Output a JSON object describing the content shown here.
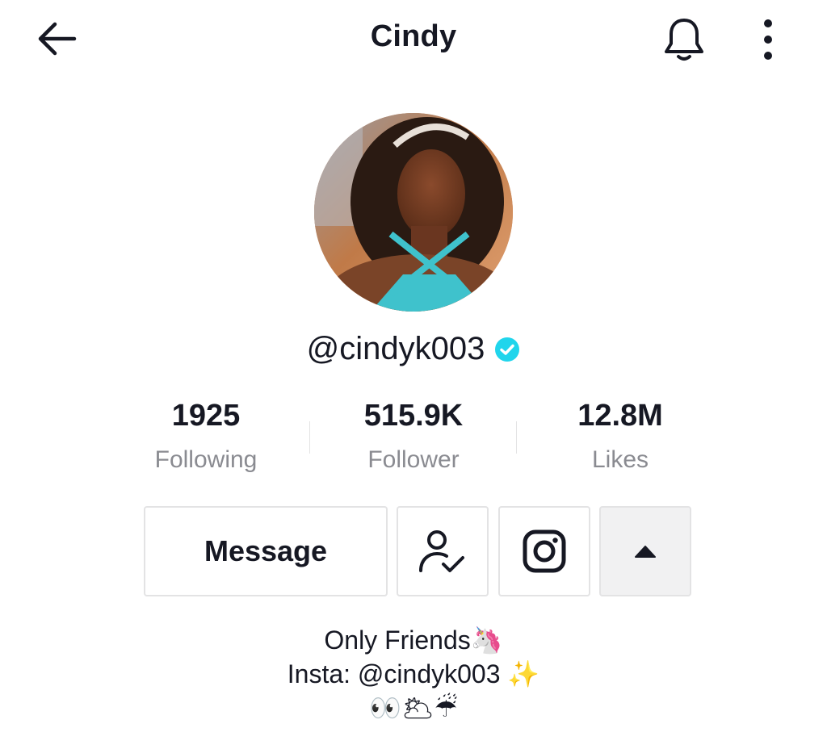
{
  "header": {
    "title": "Cindy",
    "back_icon": "arrow-left-icon",
    "notify_icon": "bell-icon",
    "more_icon": "more-vertical-icon"
  },
  "profile": {
    "username": "@cindyk003",
    "verified": true,
    "verified_color": "#20d5ec"
  },
  "stats": [
    {
      "value": "1925",
      "label": "Following"
    },
    {
      "value": "515.9K",
      "label": "Follower"
    },
    {
      "value": "12.8M",
      "label": "Likes"
    }
  ],
  "actions": {
    "message_label": "Message",
    "friend_icon": "user-check-icon",
    "instagram_icon": "instagram-icon",
    "expand_icon": "caret-up-icon"
  },
  "bio": {
    "line1": "Only Friends🦄",
    "line2": "Insta: @cindyk003 ✨",
    "line3": "👀🌥☔"
  }
}
